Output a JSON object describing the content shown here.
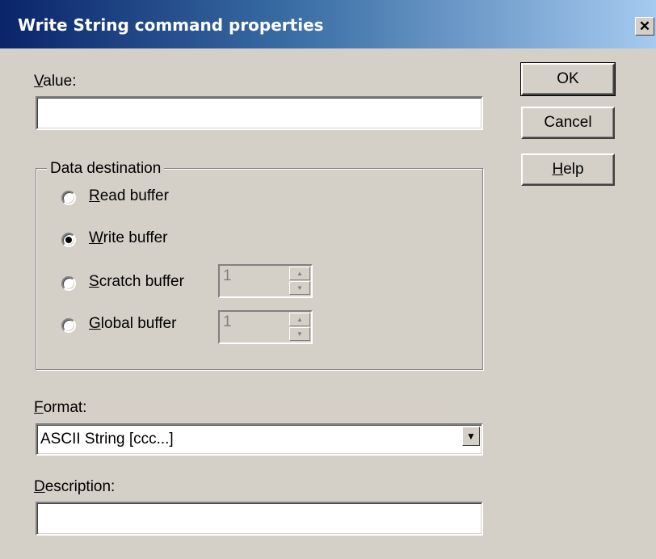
{
  "window": {
    "title": "Write String command properties",
    "close_glyph": "✕"
  },
  "value_field": {
    "label_key": "V",
    "label_rest": "alue:",
    "value": ""
  },
  "buttons": {
    "ok": "OK",
    "cancel": "Cancel",
    "help_key": "H",
    "help_rest": "elp"
  },
  "data_destination": {
    "title": "Data destination",
    "options": [
      {
        "key": "R",
        "rest": "ead buffer",
        "selected": false
      },
      {
        "key": "W",
        "rest": "rite buffer",
        "selected": true
      },
      {
        "key": "S",
        "rest": "cratch buffer",
        "selected": false,
        "spin_value": "1"
      },
      {
        "key": "G",
        "rest": "lobal buffer",
        "selected": false,
        "spin_value": "1"
      }
    ]
  },
  "format": {
    "label_key": "F",
    "label_rest": "ormat:",
    "selected": "ASCII String  [ccc...]"
  },
  "description": {
    "label_key": "D",
    "label_rest": "escription:",
    "value": ""
  },
  "icons": {
    "close": "close-icon",
    "dropdown": "chevron-down-icon",
    "spin_up": "spin-up-icon",
    "spin_down": "spin-down-icon",
    "radio_dot": "radio-dot-icon"
  }
}
